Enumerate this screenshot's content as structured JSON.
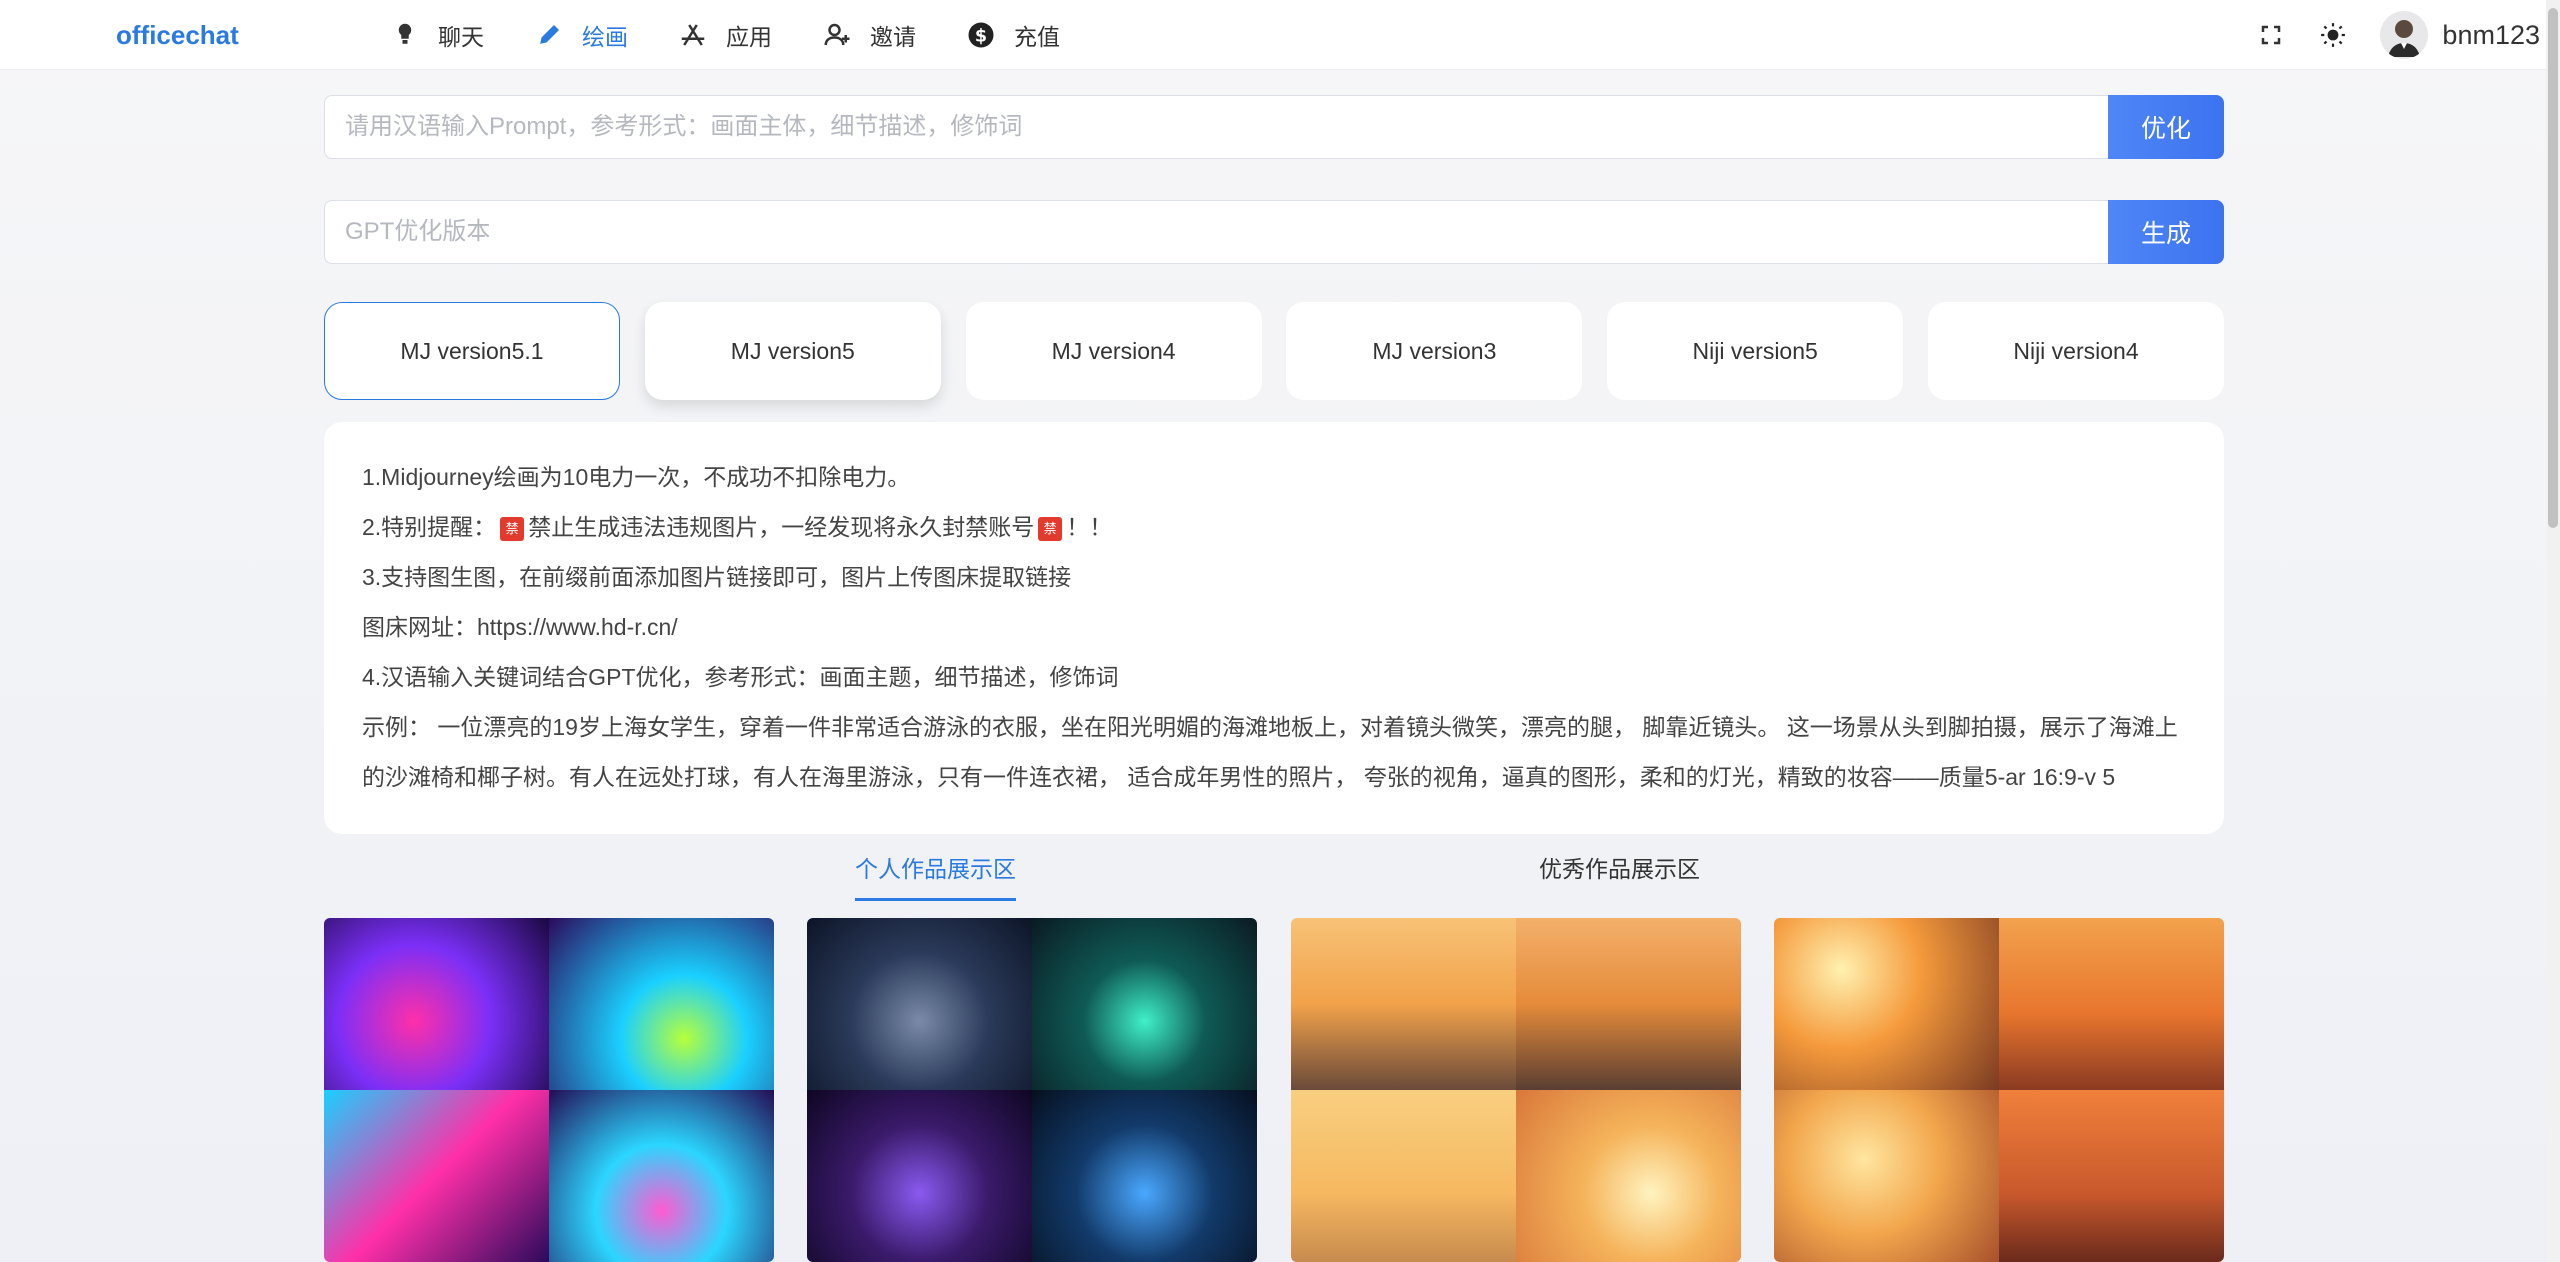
{
  "app": {
    "brand": "officechat"
  },
  "nav": {
    "items": [
      {
        "label": "聊天",
        "icon": "lightbulb-icon"
      },
      {
        "label": "绘画",
        "icon": "pencil-icon"
      },
      {
        "label": "应用",
        "icon": "app-store-icon"
      },
      {
        "label": "邀请",
        "icon": "invite-user-icon"
      },
      {
        "label": "充值",
        "icon": "dollar-icon"
      }
    ],
    "active": "绘画"
  },
  "header": {
    "username": "bnm123",
    "icons": [
      "fullscreen-icon",
      "theme-sun-icon",
      "avatar"
    ]
  },
  "prompt": {
    "placeholder": "请用汉语输入Prompt，参考形式：画面主体，细节描述，修饰词",
    "value": "",
    "button": "优化"
  },
  "gpt": {
    "placeholder": "GPT优化版本",
    "value": "",
    "button": "生成"
  },
  "versions": {
    "items": [
      "MJ version5.1",
      "MJ version5",
      "MJ version4",
      "MJ version3",
      "Niji version5",
      "Niji version4"
    ],
    "selected": "MJ version5.1"
  },
  "info": {
    "line1": "1.Midjourney绘画为10电力一次，不成功不扣除电力。",
    "line2_prefix": "2.特别提醒：",
    "ban_badge": "禁",
    "line2_mid": "禁止生成违法违规图片，一经发现将永久封禁账号",
    "line2_suffix": "！！",
    "line3": "3.支持图生图，在前缀前面添加图片链接即可，图片上传图床提取链接",
    "line4": "图床网址：https://www.hd-r.cn/",
    "line5": "4.汉语输入关键词结合GPT优化，参考形式：画面主题，细节描述，修饰词",
    "line6": "示例： 一位漂亮的19岁上海女学生，穿着一件非常适合游泳的衣服，坐在阳光明媚的海滩地板上，对着镜头微笑，漂亮的腿， 脚靠近镜头。 这一场景从头到脚拍摄，展示了海滩上的沙滩椅和椰子树。有人在远处打球，有人在海里游泳，只有一件连衣裙， 适合成年男性的照片， 夸张的视角，逼真的图形，柔和的灯光，精致的妆容——质量5-ar 16:9-v 5"
  },
  "tabs": {
    "items": [
      "个人作品展示区",
      "优秀作品展示区"
    ],
    "active": "个人作品展示区"
  },
  "gallery": {
    "cards": [
      {
        "name": "neon-motorcycle-riders",
        "colors": [
          "#7b2ff7",
          "#ff2fa8",
          "#1ad0ff",
          "#2b0a5c"
        ]
      },
      {
        "name": "cyberpunk-dogs",
        "colors": [
          "#1b2a4a",
          "#0f5a55",
          "#3a1a6a",
          "#0d2b4a"
        ]
      },
      {
        "name": "anime-girl-sunset-1",
        "colors": [
          "#f2a24a",
          "#e58b3a",
          "#f6b860",
          "#d9773a"
        ]
      },
      {
        "name": "anime-girl-sunset-2",
        "colors": [
          "#f59a3c",
          "#e8762e",
          "#f2a64c",
          "#c9592c"
        ]
      }
    ]
  }
}
